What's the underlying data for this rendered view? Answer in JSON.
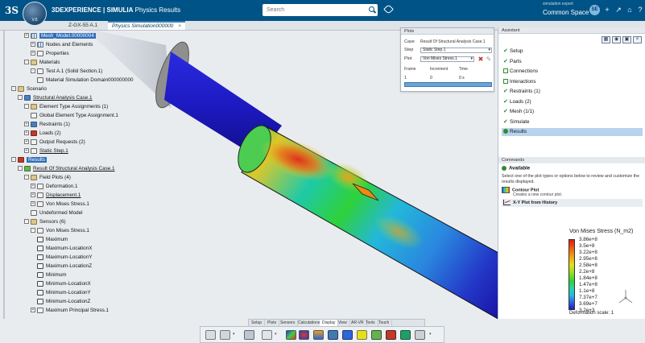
{
  "app": {
    "compass_label": "V.6",
    "title_brand": "3DEXPERIENCE | SIMULIA",
    "title_app": "Physics Results",
    "ds_logo": "3S",
    "search_placeholder": "Search",
    "user_name": "simulation expert",
    "space": "Common Space",
    "avatar_initials": "SE"
  },
  "tabs": [
    {
      "label": "Z-GX-55 A.1",
      "active": false
    },
    {
      "label": "Physics Simulation000000",
      "active": true
    }
  ],
  "tree": {
    "nodes": [
      {
        "label": "Mesh_Model.00000004",
        "depth": 3,
        "icon": "grid",
        "selected": true,
        "expander": "+"
      },
      {
        "label": "Nodes and Elements",
        "depth": 4,
        "icon": "grid",
        "expander": "+"
      },
      {
        "label": "Properties",
        "depth": 4,
        "icon": "doc",
        "expander": "+"
      },
      {
        "label": "Materials",
        "depth": 3,
        "icon": "folder",
        "expander": "-"
      },
      {
        "label": "Test A.1 (Solid Section.1)",
        "depth": 4,
        "icon": "doc",
        "expander": "-"
      },
      {
        "label": "Material Simulation Domain000000000",
        "depth": 5,
        "icon": "doc"
      },
      {
        "label": "Scenario",
        "depth": 1,
        "icon": "folder",
        "expander": "-"
      },
      {
        "label": "Structural Analysis Case.1",
        "depth": 2,
        "icon": "blue",
        "expander": "-",
        "underline": true
      },
      {
        "label": "Element Type Assignments (1)",
        "depth": 3,
        "icon": "folder",
        "expander": "-"
      },
      {
        "label": "Global Element Type Assignment.1",
        "depth": 4,
        "icon": "doc"
      },
      {
        "label": "Restraints (1)",
        "depth": 3,
        "icon": "blue",
        "expander": "+"
      },
      {
        "label": "Loads (2)",
        "depth": 3,
        "icon": "red",
        "expander": "+"
      },
      {
        "label": "Output Requests (2)",
        "depth": 3,
        "icon": "doc",
        "expander": "+"
      },
      {
        "label": "Static Step.1",
        "depth": 3,
        "icon": "doc",
        "expander": "+",
        "underline": true
      },
      {
        "label": "Results",
        "depth": 1,
        "icon": "red",
        "expander": "-",
        "selected": true
      },
      {
        "label": "Result Of Structural Analysis Case.1",
        "depth": 2,
        "icon": "green",
        "expander": "-",
        "underline": true
      },
      {
        "label": "Field Plots (4)",
        "depth": 3,
        "icon": "folder",
        "expander": "-"
      },
      {
        "label": "Deformation.1",
        "depth": 4,
        "icon": "doc",
        "expander": "+"
      },
      {
        "label": "Displacement.1",
        "depth": 4,
        "icon": "doc",
        "expander": "+",
        "underline": true
      },
      {
        "label": "Von Mises Stress.1",
        "depth": 4,
        "icon": "doc",
        "expander": "+"
      },
      {
        "label": "Undeformed Model",
        "depth": 4,
        "icon": "doc"
      },
      {
        "label": "Sensors (6)",
        "depth": 3,
        "icon": "folder",
        "expander": "-"
      },
      {
        "label": "Von Mises Stress.1",
        "depth": 4,
        "icon": "doc",
        "expander": "-"
      },
      {
        "label": "Maximum",
        "depth": 5,
        "icon": "gauge"
      },
      {
        "label": "Maximum-LocationX",
        "depth": 5,
        "icon": "gauge"
      },
      {
        "label": "Maximum-LocationY",
        "depth": 5,
        "icon": "gauge"
      },
      {
        "label": "Maximum-LocationZ",
        "depth": 5,
        "icon": "gauge"
      },
      {
        "label": "Minimum",
        "depth": 5,
        "icon": "gauge"
      },
      {
        "label": "Minimum-LocationX",
        "depth": 5,
        "icon": "gauge"
      },
      {
        "label": "Minimum-LocationY",
        "depth": 5,
        "icon": "gauge"
      },
      {
        "label": "Minimum-LocationZ",
        "depth": 5,
        "icon": "gauge"
      },
      {
        "label": "Maximum Principal Stress.1",
        "depth": 4,
        "icon": "doc",
        "expander": "+"
      }
    ]
  },
  "plots": {
    "header": "Plots",
    "case_label": "Case",
    "case_value": "Result Of Structural Analysis Case.1",
    "step_label": "Step",
    "step_value": "Static Step.1",
    "plot_label": "Plot",
    "plot_value": "Von Mises Stress.1",
    "col_frame": "Frame",
    "col_increment": "Increment",
    "col_time": "Time",
    "row_frame": "1",
    "row_increment": "0",
    "row_time": "0 s"
  },
  "assistant": {
    "header": "Assistant",
    "items": [
      {
        "label": "Setup",
        "state": "check"
      },
      {
        "label": "Parts",
        "state": "check"
      },
      {
        "label": "Connections",
        "state": "box"
      },
      {
        "label": "Interactions",
        "state": "box"
      },
      {
        "label": "Restraints (1)",
        "state": "check"
      },
      {
        "label": "Loads (2)",
        "state": "check"
      },
      {
        "label": "Mesh (1/1)",
        "state": "check"
      },
      {
        "label": "Simulate",
        "state": "check"
      },
      {
        "label": "Results",
        "state": "active"
      }
    ],
    "commands_header": "Commands",
    "available_label": "Available",
    "description": "Select one of the plot types or options below to review and customize the results displayed.",
    "contour_title": "Contour Plot",
    "contour_sub": "Creates a new contour plot.",
    "xy_title": "X-Y Plot from History"
  },
  "legend": {
    "title": "Von Mises Stress (N_m2)",
    "labels": [
      "3.86e+8",
      "3.5e+8",
      "3.22e+8",
      "2.95e+8",
      "2.58e+8",
      "2.2e+8",
      "1.84e+8",
      "1.47e+8",
      "1.1e+8",
      "7.37e+7",
      "3.69e+7",
      "3.2e+3"
    ],
    "footer": "Deformation scale: 1"
  },
  "bottom_tabs": [
    {
      "label": "Setup",
      "active": false
    },
    {
      "label": "Plots",
      "active": false
    },
    {
      "label": "Sensors",
      "active": false
    },
    {
      "label": "Calculations",
      "active": false
    },
    {
      "label": "Display",
      "active": true
    },
    {
      "label": "View",
      "active": false
    },
    {
      "label": "AR-VR",
      "active": false
    },
    {
      "label": "Tools",
      "active": false
    },
    {
      "label": "Touch",
      "active": false
    }
  ],
  "colors": {
    "brand": "#005386",
    "accent": "#3e7bb3",
    "ok": "#2e8b2e"
  }
}
